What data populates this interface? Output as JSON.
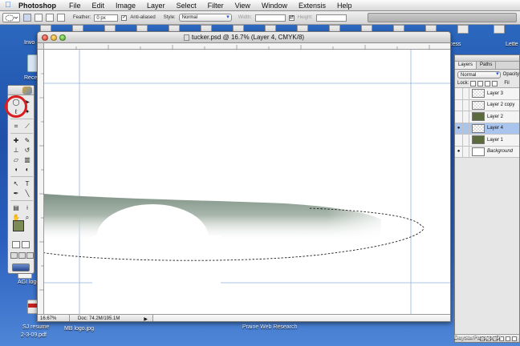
{
  "menubar": {
    "app_name": "Photoshop",
    "items": [
      "File",
      "Edit",
      "Image",
      "Layer",
      "Select",
      "Filter",
      "View",
      "Window",
      "Extensis",
      "Help"
    ]
  },
  "options": {
    "feather_label": "Feather:",
    "feather_value": "0 px",
    "antialiased_label": "Anti-aliased",
    "style_label": "Style:",
    "style_value": "Normal",
    "width_label": "Width:",
    "height_label": "Height:"
  },
  "desktop": {
    "labels": {
      "invo": "Invo",
      "rece": "Rece",
      "agi_logo": "AGI logo",
      "sj_resume": "SJ resume",
      "sj_resume_2": "2-3-09.pdf",
      "mb_logo": "MB logo.jpg",
      "prairie": "Prairie Web Research",
      "daystar": "DaystarPassportDi",
      "lette": "Lette",
      "cess": "cess"
    }
  },
  "document": {
    "title": "tucker.psd @ 16.7% (Layer 4, CMYK/8)",
    "zoom": "16.67%",
    "doc_info": "Doc: 74.2M/195.1M"
  },
  "layers_panel": {
    "tabs": [
      "Layers",
      "Paths"
    ],
    "blend_mode": "Normal",
    "opacity_label": "Opacity",
    "lock_label": "Lock:",
    "fill_label": "Fil",
    "layers": [
      {
        "name": "Layer 3",
        "visible": false,
        "thumb": "checker",
        "selected": false
      },
      {
        "name": "Layer 2 copy",
        "visible": false,
        "thumb": "checker",
        "selected": false
      },
      {
        "name": "Layer 2",
        "visible": false,
        "thumb": "dark",
        "selected": false
      },
      {
        "name": "Layer 4",
        "visible": true,
        "thumb": "checker",
        "selected": true
      },
      {
        "name": "Layer 1",
        "visible": false,
        "thumb": "dark",
        "selected": false
      },
      {
        "name": "Background",
        "visible": true,
        "thumb": "white",
        "selected": false
      }
    ]
  },
  "colors": {
    "foreground": "#7c8a55",
    "highlight_circle": "#d81e1e",
    "shape_fill": "#8a9a8c"
  }
}
